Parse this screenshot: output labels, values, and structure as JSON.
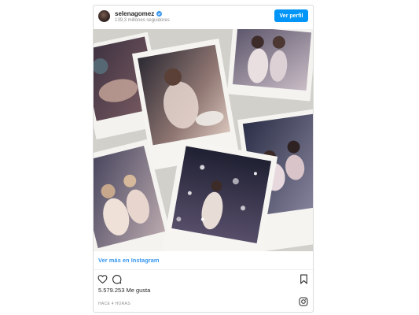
{
  "post": {
    "username": "selenagomez",
    "followers": "139,3 millones seguidores",
    "view_profile_label": "Ver perfil",
    "more_link": "Ver más en Instagram",
    "likes": "5.579.253 Me gusta",
    "timestamp": "HACE 4 HORAS"
  },
  "icons": {
    "verified": "verified-badge-icon",
    "heart": "heart-icon",
    "comment": "comment-icon",
    "bookmark": "bookmark-icon",
    "instagram": "instagram-logo-icon"
  },
  "colors": {
    "accent": "#0095f6",
    "link": "#3897f0",
    "text": "#262626",
    "muted": "#8e8e8e",
    "border": "#dbdbdb"
  }
}
